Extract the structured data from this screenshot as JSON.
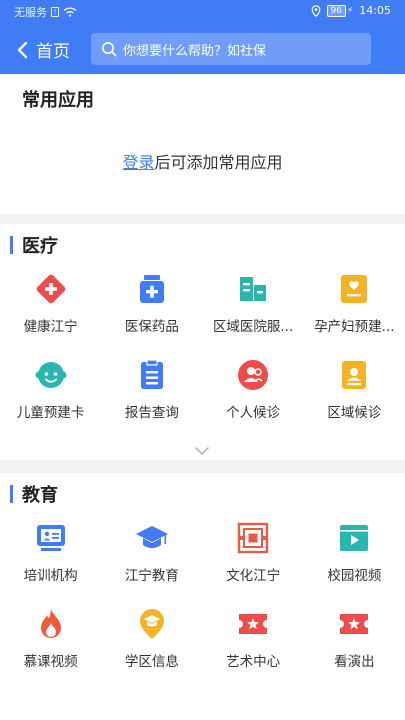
{
  "status_bar": {
    "carrier": "无服务",
    "battery": "96",
    "time": "14:05"
  },
  "nav": {
    "back_label": "首页",
    "search_placeholder": "你想要什么帮助？如社保"
  },
  "favorites": {
    "title": "常用应用",
    "login_link": "登录",
    "login_suffix": "后可添加常用应用"
  },
  "medical": {
    "title": "医疗",
    "items": [
      {
        "label": "健康江宁",
        "icon": "health-cross-icon",
        "color": "#ee4b4b"
      },
      {
        "label": "医保药品",
        "icon": "medicine-box-icon",
        "color": "#3f7cf5"
      },
      {
        "label": "区域医院服...",
        "icon": "hospital-icon",
        "color": "#27b6b0"
      },
      {
        "label": "孕产妇预建...",
        "icon": "maternal-card-icon",
        "color": "#f5b323"
      },
      {
        "label": "儿童预建卡",
        "icon": "child-face-icon",
        "color": "#27b6b0"
      },
      {
        "label": "报告查询",
        "icon": "report-icon",
        "color": "#3f7cf5"
      },
      {
        "label": "个人候诊",
        "icon": "person-wait-icon",
        "color": "#ee4b4b"
      },
      {
        "label": "区域候诊",
        "icon": "region-wait-icon",
        "color": "#f5b323"
      }
    ]
  },
  "education": {
    "title": "教育",
    "items": [
      {
        "label": "培训机构",
        "icon": "training-screen-icon",
        "color": "#3f7cf5"
      },
      {
        "label": "江宁教育",
        "icon": "graduation-cap-icon",
        "color": "#3f7cf5"
      },
      {
        "label": "文化江宁",
        "icon": "culture-pattern-icon",
        "color": "#e65a4a"
      },
      {
        "label": "校园视频",
        "icon": "video-play-icon",
        "color": "#27b6b0"
      },
      {
        "label": "慕课视频",
        "icon": "flame-icon",
        "color": "#ee5a3a"
      },
      {
        "label": "学区信息",
        "icon": "school-pin-icon",
        "color": "#f5b323"
      },
      {
        "label": "艺术中心",
        "icon": "art-ticket-icon",
        "color": "#ee4b4b"
      },
      {
        "label": "看演出",
        "icon": "show-ticket-icon",
        "color": "#ee4b4b"
      }
    ]
  }
}
